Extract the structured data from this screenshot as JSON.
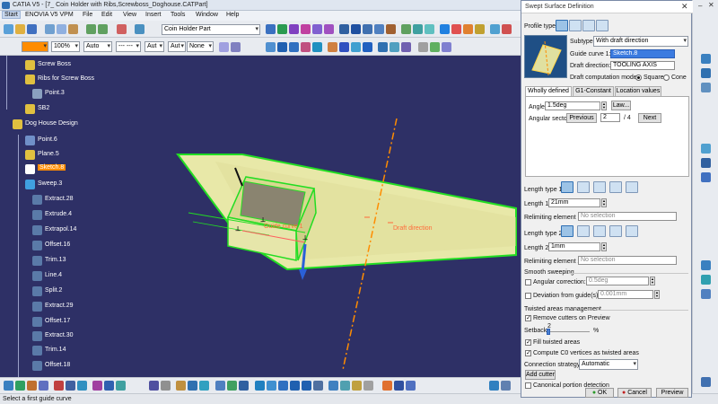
{
  "window": {
    "title": "CATIA V5 - [7_ Coin Holder with Ribs,Screwboss_Doghouse.CATPart]"
  },
  "menu": {
    "items": [
      "Start",
      "ENOVIA V5 VPM",
      "File",
      "Edit",
      "View",
      "Insert",
      "Tools",
      "Window",
      "Help"
    ]
  },
  "toolbar": {
    "color_combo": "",
    "transparency": "100%",
    "line_weight": "Auto",
    "line_type": "--- ---",
    "layer_1": "Aut",
    "layer_2": "Aut",
    "layer_3": "None",
    "part_combo": "Coin Holder Part"
  },
  "tree": {
    "nodes": [
      {
        "label": "Screw Boss",
        "level": 1,
        "icon": "screw-boss-icon"
      },
      {
        "label": "Ribs for Screw Boss",
        "level": 1,
        "icon": "ribs-icon"
      },
      {
        "label": "Point.3",
        "level": 2,
        "icon": "point-icon"
      },
      {
        "label": "SB2",
        "level": 1,
        "icon": "sb2-icon"
      },
      {
        "label": "Dog House Design",
        "level": 0,
        "icon": "dog-house-icon"
      },
      {
        "label": "Point.6",
        "level": 1,
        "icon": "point-icon"
      },
      {
        "label": "Plane.5",
        "level": 1,
        "icon": "plane-icon"
      },
      {
        "label": "Sketch.8",
        "level": 1,
        "icon": "sketch-icon",
        "selected": true
      },
      {
        "label": "Sweep.3",
        "level": 1,
        "icon": "sweep-icon"
      },
      {
        "label": "Extract.28",
        "level": 1,
        "icon": "extract-icon"
      },
      {
        "label": "Extrude.4",
        "level": 1,
        "icon": "extrude-icon"
      },
      {
        "label": "Extrapol.14",
        "level": 1,
        "icon": "extrapol-icon"
      },
      {
        "label": "Offset.16",
        "level": 1,
        "icon": "offset-icon"
      },
      {
        "label": "Trim.13",
        "level": 1,
        "icon": "trim-icon"
      },
      {
        "label": "Line.4",
        "level": 1,
        "icon": "line-icon"
      },
      {
        "label": "Split.2",
        "level": 1,
        "icon": "split-icon"
      },
      {
        "label": "Extract.29",
        "level": 1,
        "icon": "extract-icon"
      },
      {
        "label": "Offset.17",
        "level": 1,
        "icon": "offset-icon"
      },
      {
        "label": "Extract.30",
        "level": 1,
        "icon": "extract-icon"
      },
      {
        "label": "Trim.14",
        "level": 1,
        "icon": "trim-icon"
      },
      {
        "label": "Offset.18",
        "level": 1,
        "icon": "offset-icon"
      }
    ]
  },
  "viewport": {
    "guide_label": "Guide curve 1",
    "draft_label": "Draft direction",
    "accent_surface": "#e8e8a8",
    "accent_edge": "#22dd22",
    "draft_color": "#ff8c00"
  },
  "status": {
    "text": "Select a first guide curve"
  },
  "dialog": {
    "title": "Swept Surface Definition",
    "profile_type_label": "Profile type:",
    "subtype_label": "Subtype:",
    "subtype_value": "With draft direction",
    "guide_curve_label": "Guide curve 1:",
    "guide_curve_value": "Sketch.8",
    "draft_direction_label": "Draft direction:",
    "draft_direction_value": "TOOLING AXIS",
    "draft_mode_label": "Draft computation mode:",
    "mode_square": "Square",
    "mode_cone": "Cone",
    "tabs": [
      "Wholly defined",
      "G1-Constant",
      "Location values"
    ],
    "angle_label": "Angle:",
    "angle_value": "1.5deg",
    "law_button": "Law...",
    "angular_sector_label": "Angular sector:",
    "previous_button": "Previous",
    "sector_value": "2",
    "sector_total": "/ 4",
    "next_button": "Next",
    "length_type_1_label": "Length type 1:",
    "length_1_label": "Length 1:",
    "length_1_value": "21mm",
    "relimiting_1_label": "Relimiting element 1:",
    "relimiting_1_value": "No selection",
    "length_type_2_label": "Length type 2:",
    "length_2_label": "Length 2:",
    "length_2_value": "1mm",
    "relimiting_2_label": "Relimiting element 2:",
    "relimiting_2_value": "No selection",
    "smooth_sweeping_label": "Smooth sweeping",
    "angular_correction_label": "Angular correction:",
    "angular_correction_value": "0.5deg",
    "deviation_label": "Deviation from guide(s):",
    "deviation_value": "0.001mm",
    "twisted_label": "Twisted areas management",
    "remove_cutters_label": "Remove cutters on Preview",
    "setback_label": "Setback:",
    "setback_value": "2",
    "setback_unit": "%",
    "fill_twisted_label": "Fill twisted areas",
    "compute_c0_label": "Compute C0 vertices as twisted areas",
    "connection_label": "Connection strategy:",
    "connection_value": "Automatic",
    "add_cutter_button": "Add cutter",
    "canonical_label": "Canonical portion detection",
    "ok_button": "OK",
    "cancel_button": "Cancel",
    "preview_button": "Preview"
  }
}
